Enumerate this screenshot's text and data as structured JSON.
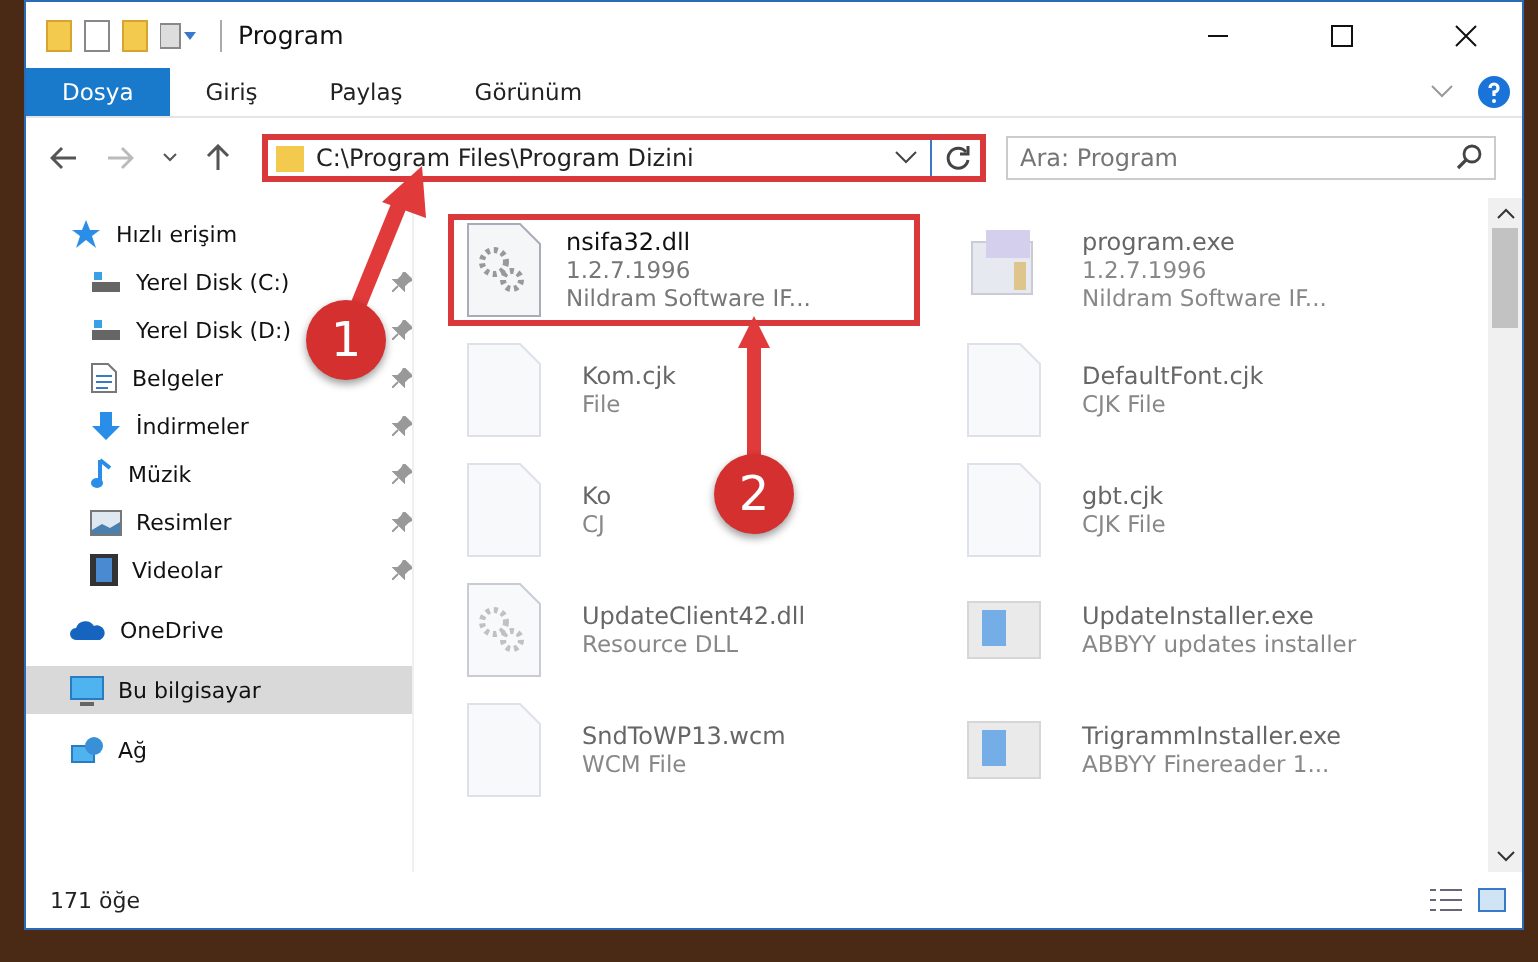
{
  "window": {
    "title": "Program"
  },
  "ribbon_tabs": [
    {
      "label": "Dosya",
      "selected": true
    },
    {
      "label": "Giriş",
      "selected": false
    },
    {
      "label": "Paylaş",
      "selected": false
    },
    {
      "label": "Görünüm",
      "selected": false
    }
  ],
  "address": {
    "path": "C:\\Program Files\\Program Dizini",
    "highlighted": true
  },
  "search": {
    "placeholder": "Ara: Program"
  },
  "sidebar": {
    "items": [
      {
        "label": "Hızlı erişim",
        "kind": "star",
        "pinned": false,
        "selected": false,
        "children": [
          {
            "label": "Yerel Disk (C:)",
            "kind": "disk",
            "pinned": true,
            "selected": false
          },
          {
            "label": "Yerel Disk (D:)",
            "kind": "disk",
            "pinned": true,
            "selected": false
          },
          {
            "label": "Belgeler",
            "kind": "doc",
            "pinned": true,
            "selected": false
          },
          {
            "label": "İndirmeler",
            "kind": "down",
            "pinned": true,
            "selected": false
          },
          {
            "label": "Müzik",
            "kind": "music",
            "pinned": true,
            "selected": false
          },
          {
            "label": "Resimler",
            "kind": "picture",
            "pinned": true,
            "selected": false
          },
          {
            "label": "Videolar",
            "kind": "video",
            "pinned": true,
            "selected": false
          }
        ]
      },
      {
        "label": "OneDrive",
        "kind": "cloud",
        "pinned": false,
        "selected": false
      },
      {
        "label": "Bu bilgisayar",
        "kind": "pc",
        "pinned": false,
        "selected": true
      },
      {
        "label": "Ağ",
        "kind": "network",
        "pinned": false,
        "selected": false
      }
    ]
  },
  "files": [
    {
      "name": "nsifa32.dll",
      "lines": [
        "1.2.7.1996",
        "Nildram Software IF..."
      ],
      "kind": "gear",
      "faded": false,
      "highlighted": true
    },
    {
      "name": "program.exe",
      "lines": [
        "1.2.7.1996",
        "Nildram Software IF..."
      ],
      "kind": "app",
      "faded": true,
      "highlighted": false
    },
    {
      "name": "Kom.cjk",
      "lines": [
        "File"
      ],
      "kind": "blank",
      "faded": true,
      "highlighted": false
    },
    {
      "name": "DefaultFont.cjk",
      "lines": [
        "CJK File"
      ],
      "kind": "blank",
      "faded": true,
      "highlighted": false
    },
    {
      "name": "Ko",
      "lines": [
        "CJ"
      ],
      "kind": "blank",
      "faded": true,
      "highlighted": false
    },
    {
      "name": "gbt.cjk",
      "lines": [
        "CJK File"
      ],
      "kind": "blank",
      "faded": true,
      "highlighted": false
    },
    {
      "name": "UpdateClient42.dll",
      "lines": [
        "Resource DLL"
      ],
      "kind": "gear",
      "faded": true,
      "highlighted": false
    },
    {
      "name": "UpdateInstaller.exe",
      "lines": [
        "ABBYY updates installer"
      ],
      "kind": "installer",
      "faded": true,
      "highlighted": false
    },
    {
      "name": "SndToWP13.wcm",
      "lines": [
        "WCM File"
      ],
      "kind": "blank",
      "faded": true,
      "highlighted": false
    },
    {
      "name": "TrigrammInstaller.exe",
      "lines": [
        "ABBYY Finereader 1..."
      ],
      "kind": "installer",
      "faded": true,
      "highlighted": false
    }
  ],
  "status_bar": {
    "count": "171 öğe"
  },
  "annotations": [
    {
      "label": "1"
    },
    {
      "label": "2"
    }
  ]
}
